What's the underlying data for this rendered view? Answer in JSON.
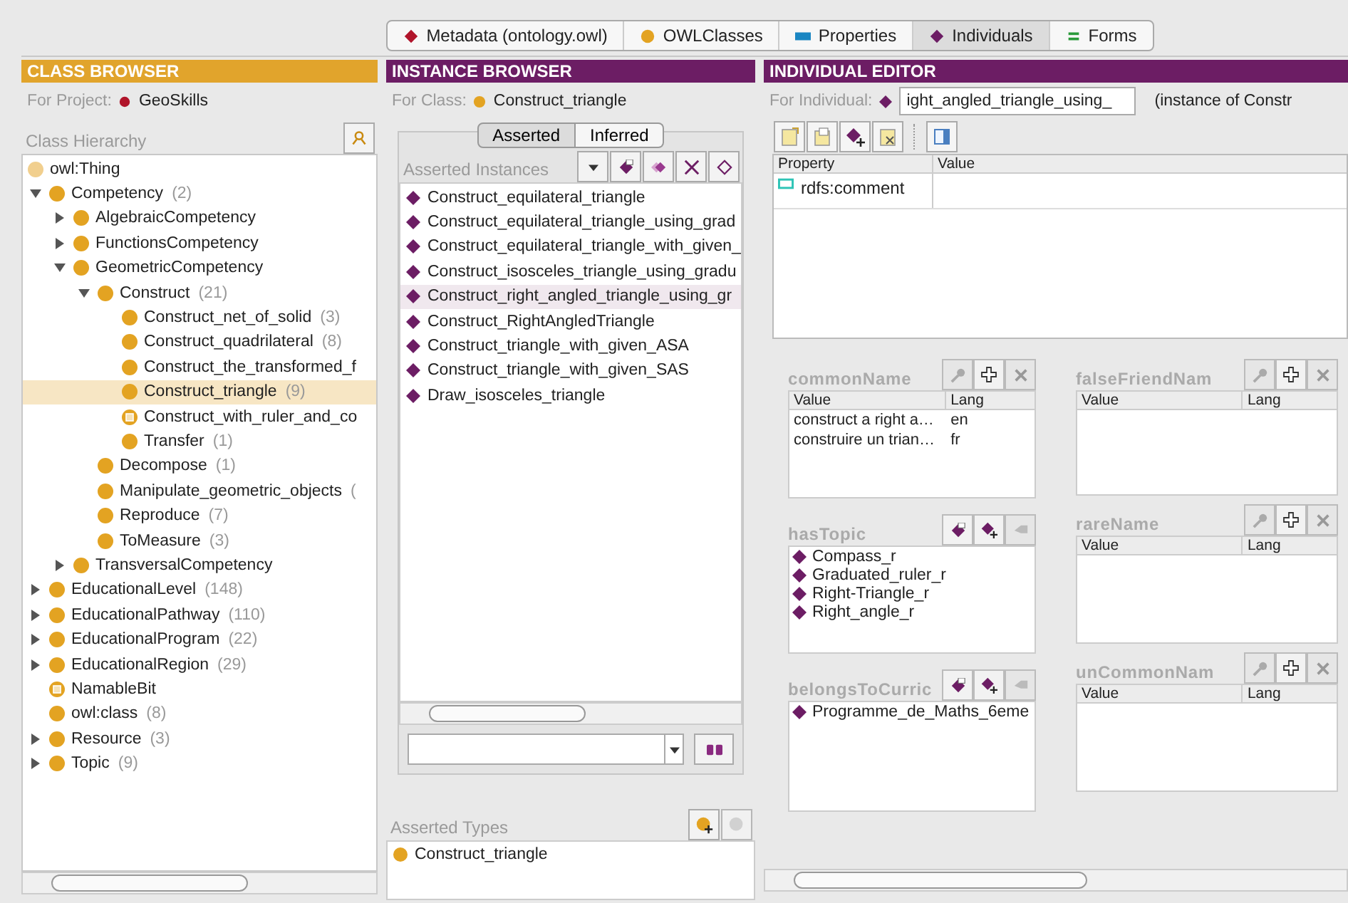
{
  "tabs": [
    {
      "label": "Metadata (ontology.owl)",
      "kind": "metadata",
      "selected": false
    },
    {
      "label": "OWLClasses",
      "kind": "classes",
      "selected": false
    },
    {
      "label": "Properties",
      "kind": "properties",
      "selected": false
    },
    {
      "label": "Individuals",
      "kind": "individuals",
      "selected": true
    },
    {
      "label": "Forms",
      "kind": "forms",
      "selected": false
    }
  ],
  "class_browser": {
    "title": "CLASS BROWSER",
    "for_label": "For Project:",
    "project": "GeoSkills",
    "hierarchy_label": "Class Hierarchy",
    "tree": [
      {
        "label": "owl:Thing",
        "kind": "root",
        "selected": false,
        "children": [
          {
            "label": "Competency",
            "count": "(2)",
            "kind": "class",
            "selected": false,
            "expanded": true,
            "children": [
              {
                "label": "AlgebraicCompetency",
                "kind": "class",
                "selected": false,
                "expanded": false
              },
              {
                "label": "FunctionsCompetency",
                "kind": "class",
                "selected": false,
                "expanded": false
              },
              {
                "label": "GeometricCompetency",
                "kind": "class",
                "selected": false,
                "expanded": true,
                "children": [
                  {
                    "label": "Construct",
                    "count": "(21)",
                    "kind": "class",
                    "selected": false,
                    "expanded": true,
                    "children": [
                      {
                        "label": "Construct_net_of_solid",
                        "count": "(3)",
                        "kind": "class",
                        "selected": false
                      },
                      {
                        "label": "Construct_quadrilateral",
                        "count": "(8)",
                        "kind": "class",
                        "selected": false
                      },
                      {
                        "label": "Construct_the_transformed_f",
                        "kind": "class",
                        "selected": false
                      },
                      {
                        "label": "Construct_triangle",
                        "count": "(9)",
                        "kind": "class",
                        "selected": true
                      },
                      {
                        "label": "Construct_with_ruler_and_co",
                        "kind": "abstract",
                        "selected": false
                      },
                      {
                        "label": "Transfer",
                        "count": "(1)",
                        "kind": "class",
                        "selected": false
                      }
                    ]
                  },
                  {
                    "label": "Decompose",
                    "count": "(1)",
                    "kind": "class",
                    "selected": false
                  },
                  {
                    "label": "Manipulate_geometric_objects",
                    "count": "(",
                    "kind": "class",
                    "selected": false
                  },
                  {
                    "label": "Reproduce",
                    "count": "(7)",
                    "kind": "class",
                    "selected": false
                  },
                  {
                    "label": "ToMeasure",
                    "count": "(3)",
                    "kind": "class",
                    "selected": false
                  }
                ]
              },
              {
                "label": "TransversalCompetency",
                "kind": "class",
                "selected": false,
                "expanded": false
              }
            ]
          },
          {
            "label": "EducationalLevel",
            "count": "(148)",
            "kind": "class",
            "selected": false,
            "expanded": false
          },
          {
            "label": "EducationalPathway",
            "count": "(110)",
            "kind": "class",
            "selected": false,
            "expanded": false
          },
          {
            "label": "EducationalProgram",
            "count": "(22)",
            "kind": "class",
            "selected": false,
            "expanded": false
          },
          {
            "label": "EducationalRegion",
            "count": "(29)",
            "kind": "class",
            "selected": false,
            "expanded": false
          },
          {
            "label": "NamableBit",
            "kind": "abstract",
            "selected": false
          },
          {
            "label": "owl:class",
            "count": "(8)",
            "kind": "class",
            "selected": false
          },
          {
            "label": "Resource",
            "count": "(3)",
            "kind": "class",
            "selected": false,
            "expanded": false
          },
          {
            "label": "Topic",
            "count": "(9)",
            "kind": "class",
            "selected": false,
            "expanded": false
          }
        ]
      }
    ]
  },
  "instance_browser": {
    "title": "INSTANCE BROWSER",
    "for_label": "For Class:",
    "class": "Construct_triangle",
    "modes": [
      {
        "label": "Asserted",
        "selected": true
      },
      {
        "label": "Inferred",
        "selected": false
      }
    ],
    "instances_label": "Asserted Instances",
    "instances": [
      {
        "label": "Construct_equilateral_triangle",
        "selected": false
      },
      {
        "label": "Construct_equilateral_triangle_using_grad",
        "selected": false
      },
      {
        "label": "Construct_equilateral_triangle_with_given_",
        "selected": false
      },
      {
        "label": "Construct_isosceles_triangle_using_gradu",
        "selected": false
      },
      {
        "label": "Construct_right_angled_triangle_using_gr",
        "selected": true
      },
      {
        "label": "Construct_RightAngledTriangle",
        "selected": false
      },
      {
        "label": "Construct_triangle_with_given_ASA",
        "selected": false
      },
      {
        "label": "Construct_triangle_with_given_SAS",
        "selected": false
      },
      {
        "label": "Draw_isosceles_triangle",
        "selected": false
      }
    ],
    "types_label": "Asserted Types",
    "types": [
      "Construct_triangle"
    ]
  },
  "individual_editor": {
    "title": "INDIVIDUAL EDITOR",
    "for_label": "For Individual:",
    "individual": "ight_angled_triangle_using_",
    "instance_of": "(instance of Constr",
    "columns": [
      "Property",
      "Value"
    ],
    "properties": [
      {
        "property": "rdfs:comment"
      }
    ],
    "widgets_left": [
      {
        "name": "commonName",
        "kind": "literal",
        "columns": [
          "Value",
          "Lang"
        ],
        "rows": [
          [
            "construct a right a…",
            "en"
          ],
          [
            "construire un trian…",
            "fr"
          ]
        ]
      },
      {
        "name": "hasTopic",
        "kind": "instances",
        "items": [
          "Compass_r",
          "Graduated_ruler_r",
          "Right-Triangle_r",
          "Right_angle_r"
        ]
      },
      {
        "name": "belongsToCurric",
        "kind": "instances",
        "items": [
          "Programme_de_Maths_6eme"
        ]
      }
    ],
    "widgets_right": [
      {
        "name": "falseFriendNam",
        "kind": "literal",
        "columns": [
          "Value",
          "Lang"
        ]
      },
      {
        "name": "rareName",
        "kind": "literal",
        "columns": [
          "Value",
          "Lang"
        ]
      },
      {
        "name": "unCommonNam",
        "kind": "literal",
        "columns": [
          "Value",
          "Lang"
        ]
      }
    ]
  }
}
